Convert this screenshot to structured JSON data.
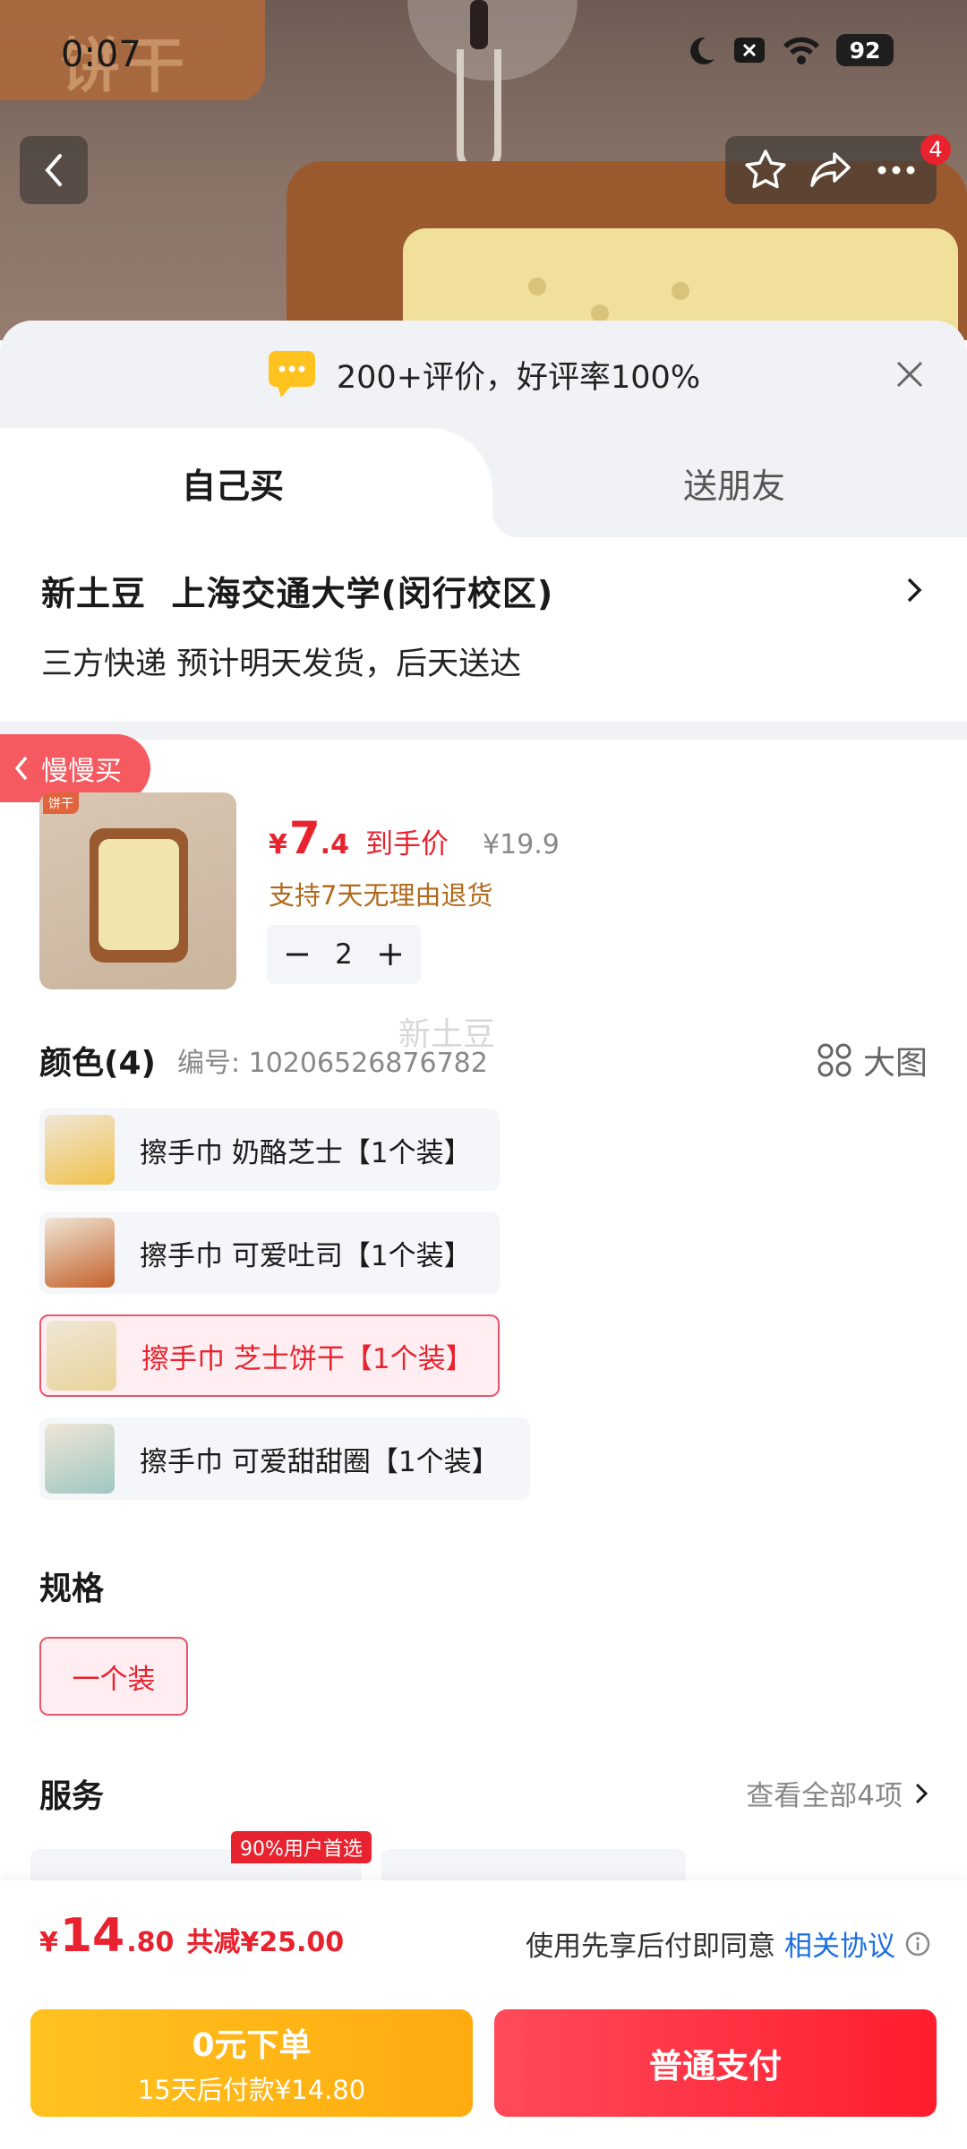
{
  "status_bar": {
    "time": "0:07",
    "battery": "92"
  },
  "hero": {
    "brand_text": "饼干"
  },
  "nav": {
    "cart_badge": "4"
  },
  "sheet": {
    "review_summary": "200+评价，好评率100%",
    "tabs": {
      "self": "自己买",
      "gift": "送朋友"
    }
  },
  "address": {
    "title": "新土豆  上海交通大学(闵行校区)",
    "delivery": "三方快递 预计明天发货，后天送达"
  },
  "slow_buy_label": "慢慢买",
  "product": {
    "thumb_tag": "饼干",
    "price_currency": "¥",
    "price_int": "7",
    "price_dec": ".4",
    "price_label": "到手价",
    "original_price": "¥19.9",
    "refund_policy": "支持7天无理由退货",
    "quantity": "2"
  },
  "watermark": "新土豆",
  "color": {
    "title": "颜色(4)",
    "code": "编号: 10206526876782",
    "big_image_label": "大图",
    "options": [
      {
        "label": "擦手巾 奶酪芝士【1个装】",
        "selected": false,
        "swatch": "#f0c14a"
      },
      {
        "label": "擦手巾 可爱吐司【1个装】",
        "selected": false,
        "swatch": "#c4602a"
      },
      {
        "label": "擦手巾 芝士饼干【1个装】",
        "selected": true,
        "swatch": "#e9d49a"
      },
      {
        "label": "擦手巾 可爱甜甜圈【1个装】",
        "selected": false,
        "swatch": "#9fc7c2"
      }
    ]
  },
  "spec": {
    "title": "规格",
    "option": "一个装"
  },
  "service": {
    "title": "服务",
    "view_all": "查看全部4项",
    "tag": "90%用户首选"
  },
  "bottom": {
    "currency": "¥",
    "total_int": "14",
    "total_dec": ".80",
    "discount": "共减¥25.00",
    "agree_text": "使用先享后付即同意",
    "agree_link": "相关协议",
    "later_title": "0元下单",
    "later_sub": "15天后付款¥14.80",
    "pay_label": "普通支付"
  },
  "colors": {
    "accent": "#e8232f",
    "gold": "#ffb617",
    "link": "#1d6fe0"
  }
}
